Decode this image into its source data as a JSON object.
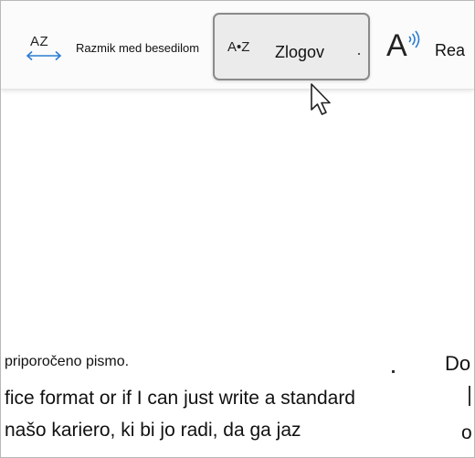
{
  "toolbar": {
    "spacing": {
      "icon_text": "AZ",
      "icon": "arrows-horizontal-icon",
      "label": "Razmik med besedilom"
    },
    "syllables": {
      "icon_text": "A•Z",
      "label": "Zlogov",
      "state": "hovered"
    },
    "read_aloud": {
      "icon_text": "A",
      "icon": "speaker-sound-waves-icon",
      "label": "Rea"
    }
  },
  "document": {
    "lines": [
      "priporočeno pismo.",
      "fice format or if I can just write a standard",
      "našo kariero, ki bi jo radi, da ga jaz"
    ],
    "right_column": {
      "line_1": "Do",
      "line_3": "o"
    }
  },
  "colors": {
    "toolbar_bg": "#fbfbfb",
    "hover_bg": "#ebebeb",
    "hover_border": "#8a8a8a",
    "accent_arrow": "#2b7cd3",
    "text": "#111111"
  }
}
